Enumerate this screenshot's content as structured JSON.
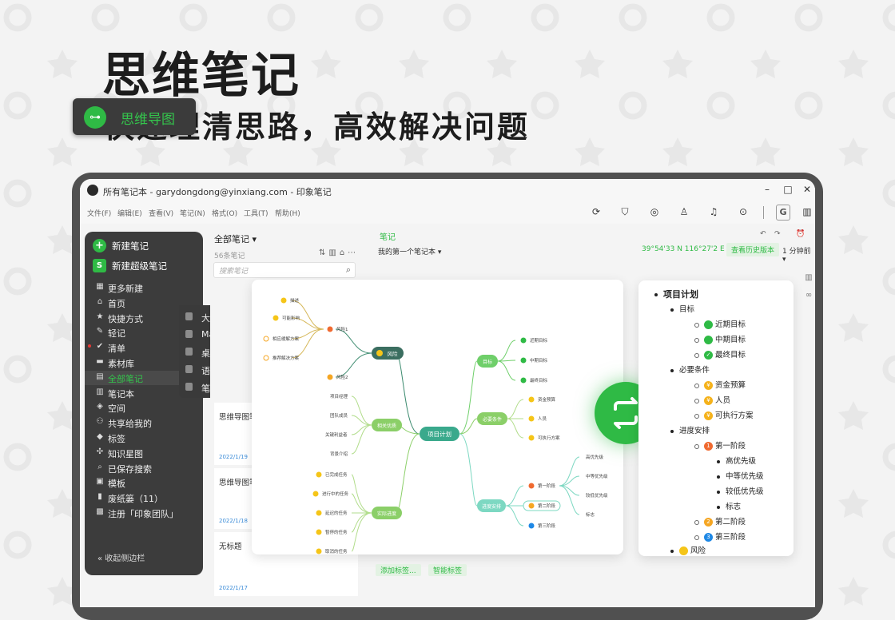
{
  "hero": {
    "title": "思维笔记",
    "subtitle": "快速理清思路，高效解决问题"
  },
  "window": {
    "title": "所有笔记本 - garydongdong@yinxiang.com - 印象笔记",
    "controls": [
      "–",
      "□",
      "✕"
    ]
  },
  "menubar": {
    "items": [
      "文件(F)",
      "编辑(E)",
      "查看(V)",
      "笔记(N)",
      "格式(O)",
      "工具(T)",
      "帮助(H)"
    ],
    "toolbar_icons": [
      "sync-icon",
      "shield-icon",
      "target-icon",
      "user-add-icon",
      "bell-icon",
      "more-icon",
      "g-icon",
      "sidebar-icon"
    ]
  },
  "sidebar": {
    "new_note": "新建笔记",
    "new_super_note": "新建超级笔记",
    "items": [
      {
        "icon": "grid-icon",
        "glyph": "▦",
        "label": "更多新建"
      },
      {
        "icon": "home-icon",
        "glyph": "⌂",
        "label": "首页"
      },
      {
        "icon": "star-icon",
        "glyph": "★",
        "label": "快捷方式"
      },
      {
        "icon": "pen-icon",
        "glyph": "✎",
        "label": "轻记"
      },
      {
        "icon": "check-icon",
        "glyph": "✔",
        "label": "清单"
      },
      {
        "icon": "folder-icon",
        "glyph": "▬",
        "label": "素材库"
      },
      {
        "icon": "notes-icon",
        "glyph": "▤",
        "label": "全部笔记"
      },
      {
        "icon": "notebook-icon",
        "glyph": "▥",
        "label": "笔记本"
      },
      {
        "icon": "space-icon",
        "glyph": "◈",
        "label": "空间"
      },
      {
        "icon": "share-icon",
        "glyph": "⚇",
        "label": "共享给我的"
      },
      {
        "icon": "tag-icon",
        "glyph": "◆",
        "label": "标签"
      },
      {
        "icon": "graph-icon",
        "glyph": "✣",
        "label": "知识星图"
      },
      {
        "icon": "search-icon",
        "glyph": "⌕",
        "label": "已保存搜索"
      },
      {
        "icon": "template-icon",
        "glyph": "▣",
        "label": "模板"
      },
      {
        "icon": "trash-icon",
        "glyph": "▮",
        "label": "废纸篓（11）"
      },
      {
        "icon": "team-icon",
        "glyph": "▩",
        "label": "注册「印象团队」"
      }
    ],
    "collapse": "« 收起侧边栏"
  },
  "submenu": {
    "highlight": "思维导图",
    "items": [
      "大纲笔记",
      "Markdown",
      "桌面便签",
      "语音笔记",
      "笔记本"
    ]
  },
  "notelist": {
    "title": "全部笔记 ▾",
    "count": "56条笔记",
    "search_placeholder": "搜索笔记",
    "cards": [
      {
        "title": "思维导图笔",
        "date": "2022/1/19"
      },
      {
        "title": "思维导图笔",
        "date": "2022/1/18"
      },
      {
        "title": "无标题",
        "date": "2022/1/17"
      }
    ]
  },
  "editor": {
    "notebook_label": "笔记",
    "notebook_path": "我的第一个笔记本 ▾",
    "coords": "39°54'33 N  116°27'2 E ▾",
    "history_btn": "查看历史版本",
    "minutes": "1 分钟前 ▾",
    "add_tag": "添加标签...",
    "smart_tag": "智能标签"
  },
  "mindmap": {
    "root": "项目计划",
    "branches": {
      "risk": "风险",
      "advantage": "相关优质",
      "progress": "实际进度",
      "goal": "目标",
      "conditions": "必要条件",
      "schedule": "进度安排"
    },
    "risk_children": [
      "风险1",
      "风险2"
    ],
    "risk1_children": [
      "描述",
      "可能影响",
      "相应缓解方案",
      "推荐解决方案"
    ],
    "advantage_children": [
      "项目经理",
      "团队成员",
      "关键利益者",
      "背景介绍"
    ],
    "progress_children": [
      "已完成任务",
      "进行中的任务",
      "延迟的任务",
      "暂停的任务",
      "取消的任务"
    ],
    "goal_children": [
      "近期目标",
      "中期目标",
      "最终目标"
    ],
    "condition_children": [
      "资金预算",
      "人员",
      "可执行方案"
    ],
    "schedule_children": [
      "第一阶段",
      "第二阶段",
      "第三阶段"
    ],
    "stage1_children": [
      "高优先级",
      "中等优先级",
      "较低优先级",
      "标志"
    ]
  },
  "outline": {
    "root": "项目计划",
    "goal": "目标",
    "goals": [
      "近期目标",
      "中期目标",
      "最终目标"
    ],
    "conditions": "必要条件",
    "condition_items": [
      "资金预算",
      "人员",
      "可执行方案"
    ],
    "schedule": "进度安排",
    "stage1": "第一阶段",
    "stage1_items": [
      "高优先级",
      "中等优先级",
      "较低优先级",
      "标志"
    ],
    "stage2": "第二阶段",
    "stage3": "第三阶段",
    "risk": "风险",
    "stage_numbers": [
      "1",
      "2",
      "3"
    ]
  },
  "colors": {
    "brand_green": "#2fba45",
    "sidebar_dark": "#3c3c3c",
    "device_frame": "#505050"
  }
}
